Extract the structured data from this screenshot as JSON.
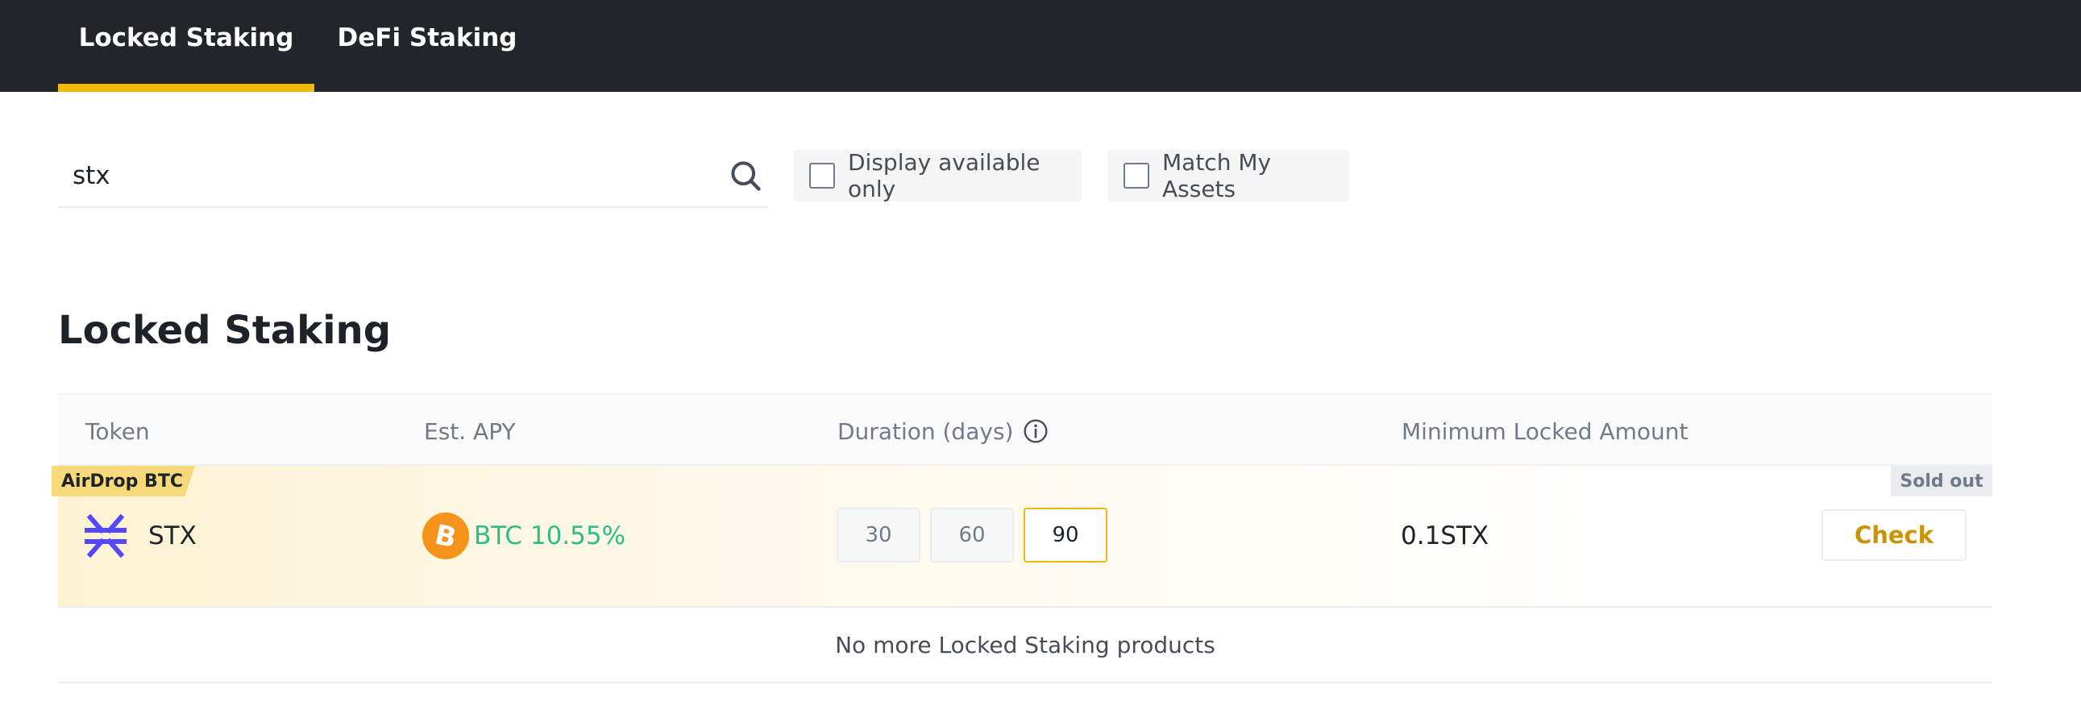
{
  "nav": {
    "tabs": [
      {
        "label": "Locked Staking",
        "active": true
      },
      {
        "label": "DeFi Staking",
        "active": false
      }
    ],
    "accent": "#f0b90b"
  },
  "search": {
    "value": "stx",
    "icon": "search-icon"
  },
  "filters": {
    "display_available": {
      "label": "Display available only",
      "checked": false
    },
    "match_assets": {
      "label": "Match My Assets",
      "checked": false
    }
  },
  "section": {
    "title": "Locked Staking"
  },
  "table": {
    "headers": {
      "token": "Token",
      "apy": "Est. APY",
      "duration": "Duration (days)",
      "min_amount": "Minimum Locked Amount"
    },
    "rows": [
      {
        "badge": "AirDrop BTC",
        "status": "Sold out",
        "token": "STX",
        "token_icon": "stacks-icon",
        "apy_icon": "bitcoin-icon",
        "apy": "BTC 10.55%",
        "durations": [
          "30",
          "60",
          "90"
        ],
        "selected_duration": "90",
        "min_amount": "0.1STX",
        "action": "Check"
      }
    ],
    "footer": "No more Locked Staking products"
  },
  "colors": {
    "apy_green": "#2ebd85",
    "check_gold": "#c99400",
    "nav_bg": "#222529"
  }
}
